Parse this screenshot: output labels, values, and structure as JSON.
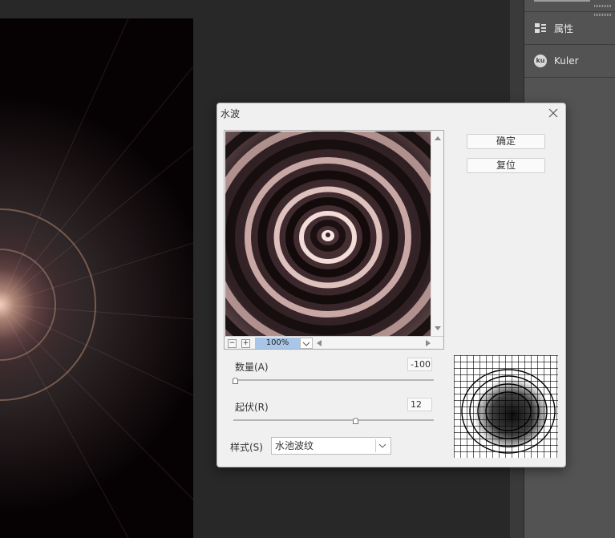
{
  "panel": {
    "items": [
      {
        "label": "属性",
        "icon": "properties-icon"
      },
      {
        "label": "Kuler",
        "icon": "kuler-icon",
        "badge": "ku"
      }
    ]
  },
  "dialog": {
    "title": "水波",
    "ok_label": "确定",
    "reset_label": "复位",
    "zoom": "100%",
    "zoom_minus": "−",
    "zoom_plus": "+",
    "amount": {
      "label": "数量(A)",
      "value": "-100",
      "fraction": 0.0
    },
    "ridges": {
      "label": "起伏(R)",
      "value": "12",
      "fraction": 0.6
    },
    "style": {
      "label": "样式(S)",
      "value": "水池波纹"
    }
  },
  "colors": {
    "dialog_bg": "#f0f0f0",
    "panel_bg": "#535353",
    "zoom_highlight": "#a9c6e8"
  }
}
